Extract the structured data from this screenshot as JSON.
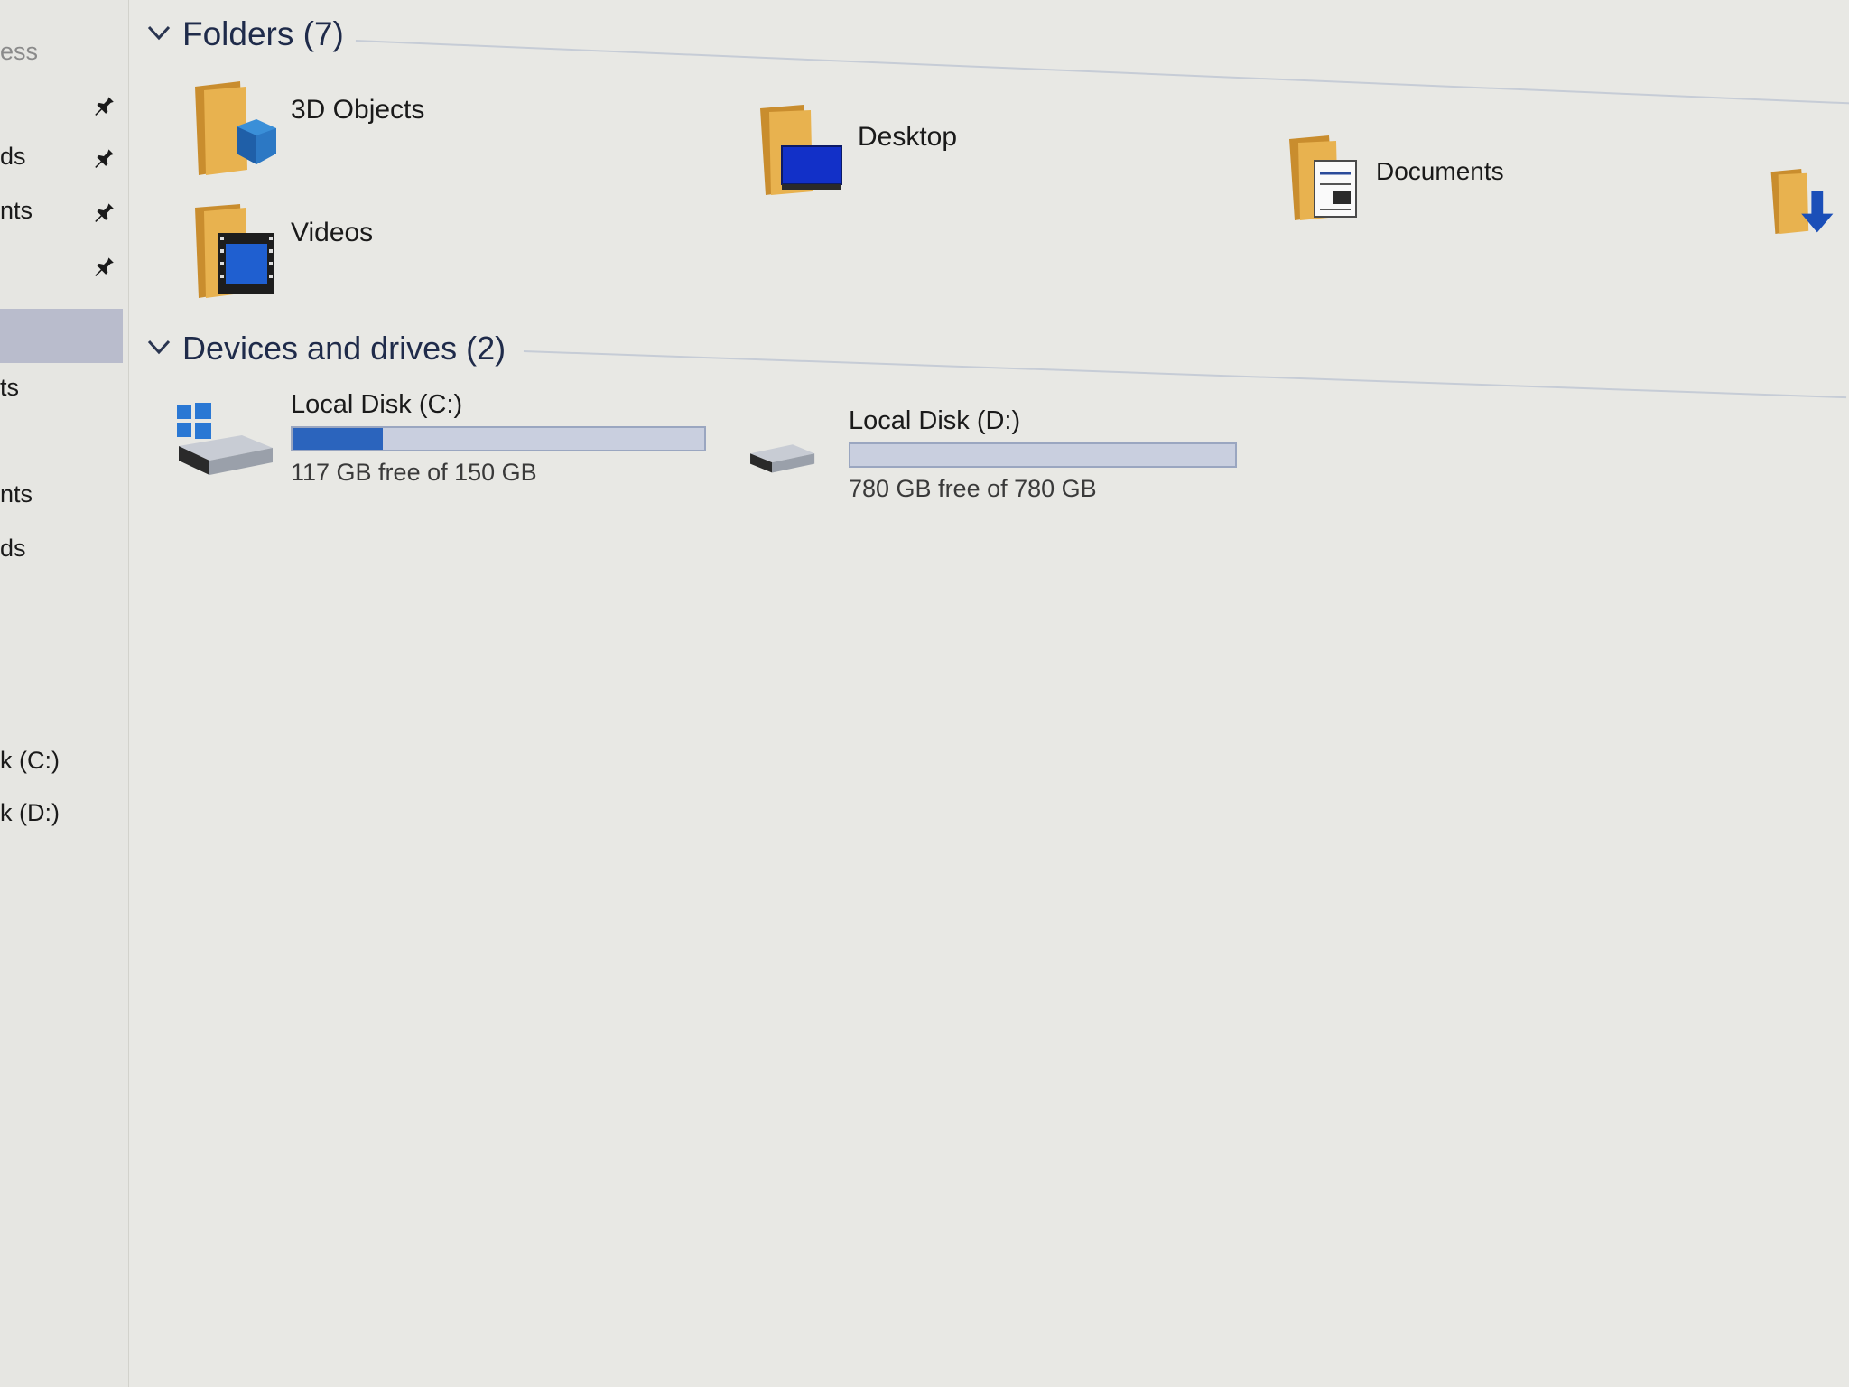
{
  "sidebar": {
    "items": [
      {
        "label": "ess",
        "pinned": false,
        "selected": false
      },
      {
        "label": "",
        "pinned": true,
        "selected": false
      },
      {
        "label": "ds",
        "pinned": true,
        "selected": false
      },
      {
        "label": "nts",
        "pinned": true,
        "selected": false
      },
      {
        "label": "",
        "pinned": true,
        "selected": false
      },
      {
        "label": "",
        "pinned": false,
        "selected": true
      },
      {
        "label": "ts",
        "pinned": false,
        "selected": false
      },
      {
        "label": "nts",
        "pinned": false,
        "selected": false
      },
      {
        "label": "ds",
        "pinned": false,
        "selected": false
      },
      {
        "label": "k (C:)",
        "pinned": false,
        "selected": false
      },
      {
        "label": "k (D:)",
        "pinned": false,
        "selected": false
      }
    ]
  },
  "folders_group": {
    "title": "Folders (7)",
    "items": [
      {
        "label": "3D Objects",
        "icon": "3d-objects-folder-icon"
      },
      {
        "label": "Desktop",
        "icon": "desktop-folder-icon"
      },
      {
        "label": "Documents",
        "icon": "documents-folder-icon"
      },
      {
        "label": "",
        "icon": "downloads-folder-icon"
      },
      {
        "label": "Videos",
        "icon": "videos-folder-icon"
      }
    ]
  },
  "drives_group": {
    "title": "Devices and drives (2)",
    "items": [
      {
        "name": "Local Disk (C:)",
        "free_text": "117 GB free of 150 GB",
        "used_fraction": 0.22,
        "icon": "windows-drive-icon"
      },
      {
        "name": "Local Disk (D:)",
        "free_text": "780 GB free of 780 GB",
        "used_fraction": 0.0,
        "icon": "hard-drive-icon"
      }
    ]
  },
  "colors": {
    "accent_bar": "#2b64bd",
    "selection": "#b9bccc",
    "folder": "#d9a441"
  }
}
